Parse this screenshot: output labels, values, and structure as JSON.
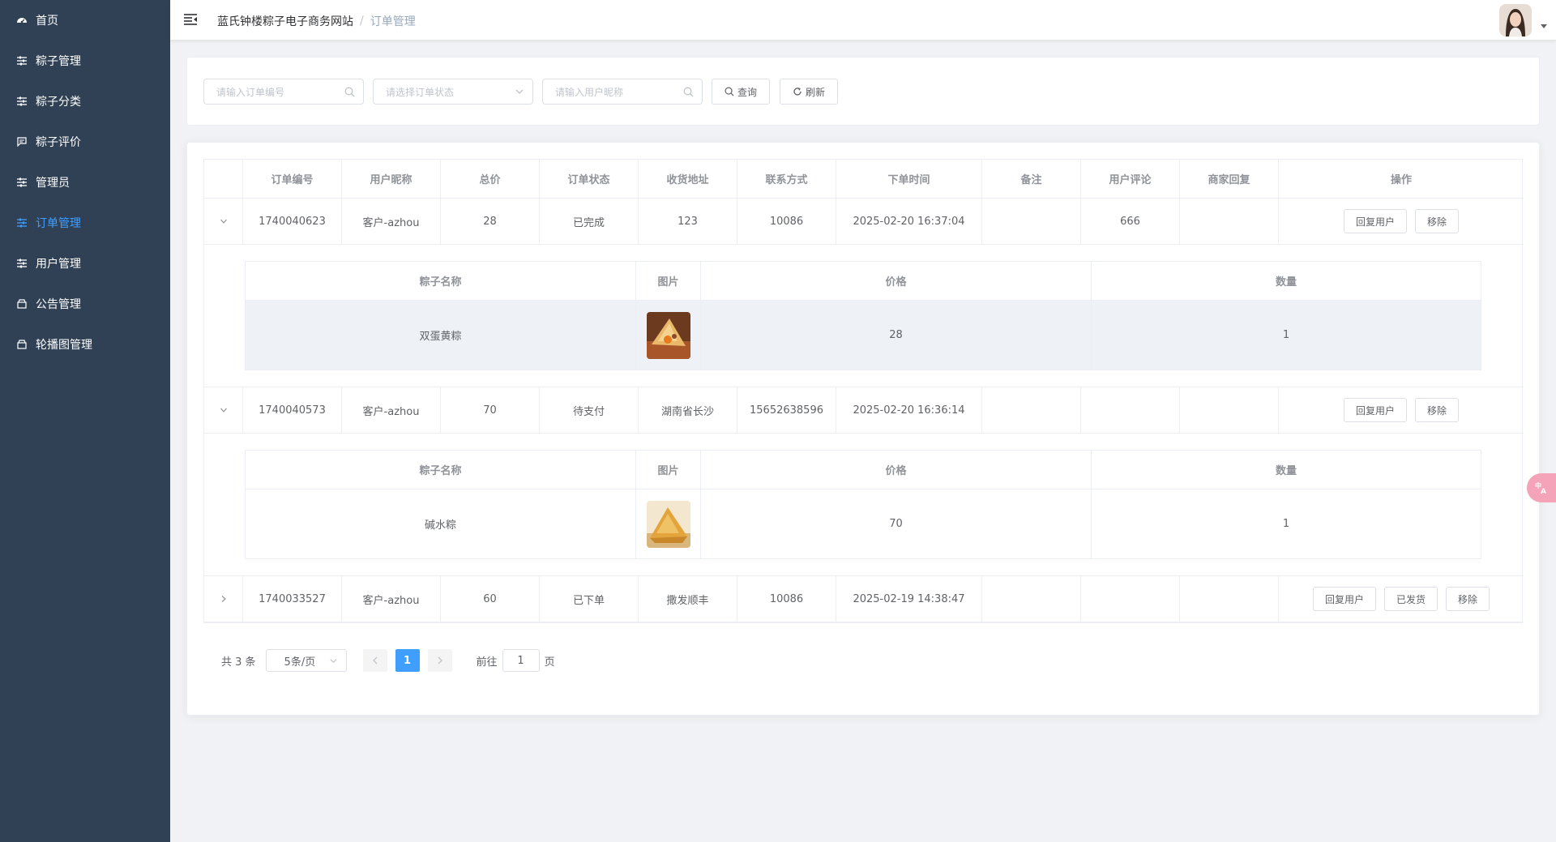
{
  "sidebar": {
    "items": [
      {
        "label": "首页",
        "icon": "dashboard-icon",
        "active": false
      },
      {
        "label": "粽子管理",
        "icon": "sliders-icon",
        "active": false
      },
      {
        "label": "粽子分类",
        "icon": "sliders-icon",
        "active": false
      },
      {
        "label": "粽子评价",
        "icon": "comment-icon",
        "active": false
      },
      {
        "label": "管理员",
        "icon": "sliders-icon",
        "active": false
      },
      {
        "label": "订单管理",
        "icon": "sliders-icon",
        "active": true
      },
      {
        "label": "用户管理",
        "icon": "sliders-icon",
        "active": false
      },
      {
        "label": "公告管理",
        "icon": "box-icon",
        "active": false
      },
      {
        "label": "轮播图管理",
        "icon": "box-icon",
        "active": false
      }
    ]
  },
  "header": {
    "breadcrumb_root": "蓝氏钟楼粽子电子商务网站",
    "breadcrumb_sep": "/",
    "breadcrumb_current": "订单管理"
  },
  "search": {
    "order_no_placeholder": "请输入订单编号",
    "status_placeholder": "请选择订单状态",
    "nickname_placeholder": "请输入用户昵称",
    "query_label": "查询",
    "refresh_label": "刷新"
  },
  "table": {
    "columns": [
      "订单编号",
      "用户昵称",
      "总价",
      "订单状态",
      "收货地址",
      "联系方式",
      "下单时间",
      "备注",
      "用户评论",
      "商家回复",
      "操作"
    ],
    "sub_columns": [
      "粽子名称",
      "图片",
      "价格",
      "数量"
    ],
    "rows": [
      {
        "order_no": "1740040623",
        "nickname": "客户-azhou",
        "total": "28",
        "status": "已完成",
        "address": "123",
        "contact": "10086",
        "time": "2025-02-20 16:37:04",
        "remark": "",
        "comment": "666",
        "reply": "",
        "actions": [
          "回复用户",
          "移除"
        ],
        "items": [
          {
            "name": "双蛋黄粽",
            "price": "28",
            "qty": "1"
          }
        ]
      },
      {
        "order_no": "1740040573",
        "nickname": "客户-azhou",
        "total": "70",
        "status": "待支付",
        "address": "湖南省长沙",
        "contact": "15652638596",
        "time": "2025-02-20 16:36:14",
        "remark": "",
        "comment": "",
        "reply": "",
        "actions": [
          "回复用户",
          "移除"
        ],
        "items": [
          {
            "name": "碱水粽",
            "price": "70",
            "qty": "1"
          }
        ]
      },
      {
        "order_no": "1740033527",
        "nickname": "客户-azhou",
        "total": "60",
        "status": "已下单",
        "address": "撒发顺丰",
        "contact": "10086",
        "time": "2025-02-19 14:38:47",
        "remark": "",
        "comment": "",
        "reply": "",
        "actions": [
          "回复用户",
          "已发货",
          "移除"
        ]
      }
    ]
  },
  "pagination": {
    "total_text": "共 3 条",
    "page_size": "5条/页",
    "current_page": "1",
    "goto_prefix": "前往",
    "goto_value": "1",
    "goto_suffix": "页"
  },
  "colors": {
    "sidebar_bg": "#304156",
    "accent": "#409eff"
  }
}
